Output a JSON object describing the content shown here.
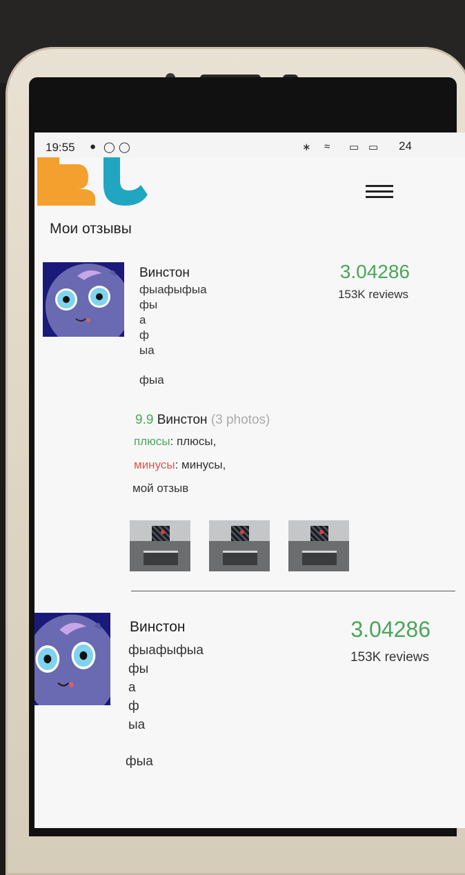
{
  "status_bar": {
    "time": "19:55",
    "battery": "24"
  },
  "app": {
    "page_title": "Мои отзывы"
  },
  "cards": [
    {
      "name": "Винстон",
      "rating": "3.04286",
      "reviews": "153K reviews",
      "description_lines": [
        "фыафыфыа",
        "фы",
        "а",
        "ф",
        "ыа"
      ],
      "extra": "фыа",
      "review": {
        "score": "9.9",
        "author": "Винстон",
        "photos": "(3 photos)",
        "pros_label": "плюсы",
        "pros_value": ": плюсы,",
        "cons_label": "минусы",
        "cons_value": ": минусы,",
        "comment": "мой отзыв"
      }
    },
    {
      "name": "Винстон",
      "rating": "3.04286",
      "reviews": "153K reviews",
      "description_lines": [
        "фыафыфыа",
        "фы",
        "а",
        "ф",
        "ыа"
      ],
      "extra": "фыа"
    }
  ],
  "colors": {
    "rating": "#4aa55a",
    "cons": "#e2554a",
    "logo_orange": "#f4a02e",
    "logo_teal": "#21a6c1"
  }
}
